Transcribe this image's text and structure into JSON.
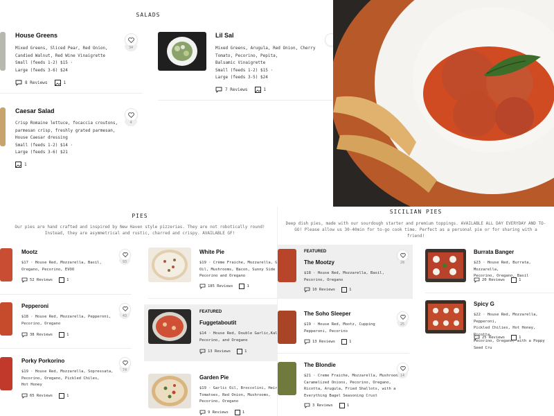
{
  "salads": {
    "title": "SALADS",
    "items": [
      {
        "name": "House Greens",
        "desc": [
          "Mixed Greens, Sliced Pear, Red Onion,",
          "Candied Walnut, Red Wine Vinaigrette",
          "Small (feeds 1-2) $15 ·",
          "Large (feeds 3-6) $24"
        ],
        "reviews": "8 Reviews",
        "photos": "1",
        "likes": "34"
      },
      {
        "name": "Lil Sal",
        "desc": [
          "Mixed Greens, Arugula, Red Onion, Cherry",
          "Tomato, Pecorino, Pepita,",
          "Balsamic Vinaigrette",
          "Small (feeds 1-2) $15 ·",
          "Large (feeds 3-5) $24"
        ],
        "reviews": "7 Reviews",
        "photos": "1",
        "likes": ""
      },
      {
        "name": "Caesar Salad",
        "desc": [
          "Crisp Romaine lettuce, focaccia croutons,",
          "parmesan crisp, freshly grated parmesan,",
          "House Caesar dressing",
          "Small (feeds 1-2) $14 ·",
          "Large (feeds 3-6) $21"
        ],
        "reviews": "",
        "photos": "1",
        "likes": "4"
      }
    ]
  },
  "pies": {
    "title": "PIES",
    "intro": [
      "Our pies are hand crafted and inspired by New Haven style pizzerias. They are not robotically round!",
      "Instead, they are asymmetrical and rustic, charred and crispy. AVAILABLE GF!"
    ],
    "left": [
      {
        "name": "Mootz",
        "desc": [
          "$17 · House Red, Mozzarella, Basil,",
          "Oregano, Pecorino, EVOO"
        ],
        "reviews": "52 Reviews",
        "photos": "1",
        "likes": "93"
      },
      {
        "name": "Pepperoni",
        "desc": [
          "$18 · House Red, Mozzarella, Pepperoni,",
          "Pecorino, Oregano"
        ],
        "reviews": "38 Reviews",
        "photos": "1",
        "likes": "43"
      },
      {
        "name": "Porky Porkorino",
        "desc": [
          "$19 · House Red, Mozzarella, Sopressata,",
          "Pecorino, Oregano, Pickled Chiles,",
          "Hot Honey"
        ],
        "reviews": "65 Reviews",
        "photos": "1",
        "likes": "74"
      }
    ],
    "right": [
      {
        "name": "White Pie",
        "desc": [
          "$19 · Crème Fraiche, Mozzarella, Gar",
          "Oil, Mushrooms, Bacon, Sunny Side Eg",
          "Pecorino and Oregano"
        ],
        "reviews": "185 Reviews",
        "photos": "1",
        "featured": ""
      },
      {
        "name": "Fuggetaboutit",
        "desc": [
          "$14 · House Red, Double Garlic,Kalam",
          "Pecorino, and Oregano"
        ],
        "reviews": "13 Reviews",
        "photos": "1",
        "featured": "FEATURED"
      },
      {
        "name": "Garden Pie",
        "desc": [
          "$19 · Garlic Oil, Broccolini, Heirlo",
          "Tomatoes, Red Onion, Mushrooms,",
          "Pecorino, Oregano"
        ],
        "reviews": "9 Reviews",
        "photos": "1",
        "featured": ""
      }
    ]
  },
  "sicilian": {
    "title": "SICILIAN PIES",
    "intro": [
      "Deep dish pies, made with our sourdough starter and premium toppings. AVAILABLE ALL DAY EVERYDAY AND TO-",
      "GO! Please allow us 30-40min for to-go cook time. Perfect as a personal pie or for sharing with a",
      "friend!"
    ],
    "left": [
      {
        "name": "The Mootzy",
        "desc": [
          "$18 · House Red, Mozzarella, Basil,",
          "Pecorino, Oregano"
        ],
        "reviews": "10 Reviews",
        "photos": "1",
        "likes": "28",
        "featured": "FEATURED"
      },
      {
        "name": "The Soho Sleeper",
        "desc": [
          "$19 · House Red, Mootz, Cupping",
          "Pepperoni, Pecorino"
        ],
        "reviews": "13 Reviews",
        "photos": "1",
        "likes": "25",
        "featured": ""
      },
      {
        "name": "The Blondie",
        "desc": [
          "$21 · Creme Fraiche, Mozzarella, Mushroom,",
          "Caramelized Onions, Pecorino, Oregano,",
          "Ricotta, Arugula, Fried Shallots, with a",
          "Everything Bagel Seasoning Crust"
        ],
        "reviews": "3 Reviews",
        "photos": "1",
        "likes": "14",
        "featured": ""
      }
    ],
    "right": [
      {
        "name": "Burrata Banger",
        "desc": [
          "$23 · House Red, Burrata, Mozzarella,",
          "Pecorino, Oregano, Basil"
        ],
        "reviews": "20 Reviews",
        "photos": "1"
      },
      {
        "name": "Spicy G",
        "desc": [
          "$22 · House Red, Mozzarella, Pepperoni,",
          "Pickled Chilies, Hot Honey, Ricotta,",
          "Pecorino, Oregano, with a Poppy Seed Cru"
        ],
        "reviews": "25 Reviews",
        "photos": "1"
      }
    ]
  },
  "icons": {
    "review": "speech-bubble-icon",
    "photo": "photo-icon",
    "like": "heart-icon"
  },
  "colors": {
    "featured_bg": "#efefef",
    "divider": "#ececec",
    "text": "#111111",
    "muted": "#888888"
  }
}
